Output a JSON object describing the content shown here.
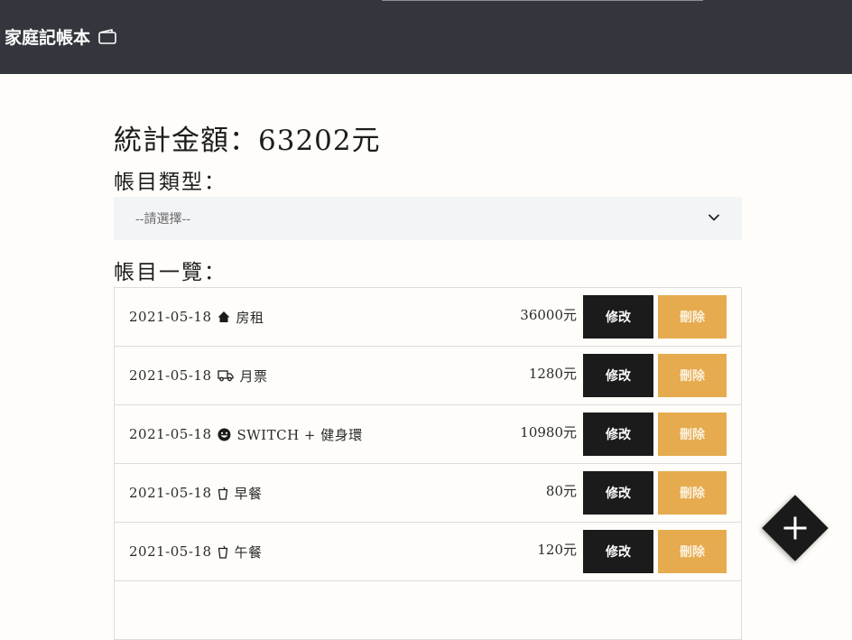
{
  "navbar": {
    "brand_label": "家庭記帳本",
    "brand_icon": "wallet-icon"
  },
  "summary": {
    "total_label": "統計金額：63202元"
  },
  "type_filter": {
    "title": "帳目類型：",
    "selected": "--請選擇--"
  },
  "list": {
    "title": "帳目一覽：",
    "edit_label": "修改",
    "delete_label": "刪除",
    "items": [
      {
        "date": "2021-05-18",
        "icon": "house-icon",
        "name": "房租",
        "amount": "36000元"
      },
      {
        "date": "2021-05-18",
        "icon": "truck-icon",
        "name": "月票",
        "amount": "1280元"
      },
      {
        "date": "2021-05-18",
        "icon": "smile-icon",
        "name": "SWITCH + 健身環",
        "amount": "10980元"
      },
      {
        "date": "2021-05-18",
        "icon": "cup-icon",
        "name": "早餐",
        "amount": "80元"
      },
      {
        "date": "2021-05-18",
        "icon": "cup-icon",
        "name": "午餐",
        "amount": "120元"
      }
    ]
  },
  "fab": {
    "icon": "plus-icon"
  },
  "colors": {
    "navbar_bg": "#33363c",
    "edit_button_bg": "#1b1b1b",
    "delete_button_bg": "#e5ab4e",
    "page_bg": "#fefdf9"
  }
}
